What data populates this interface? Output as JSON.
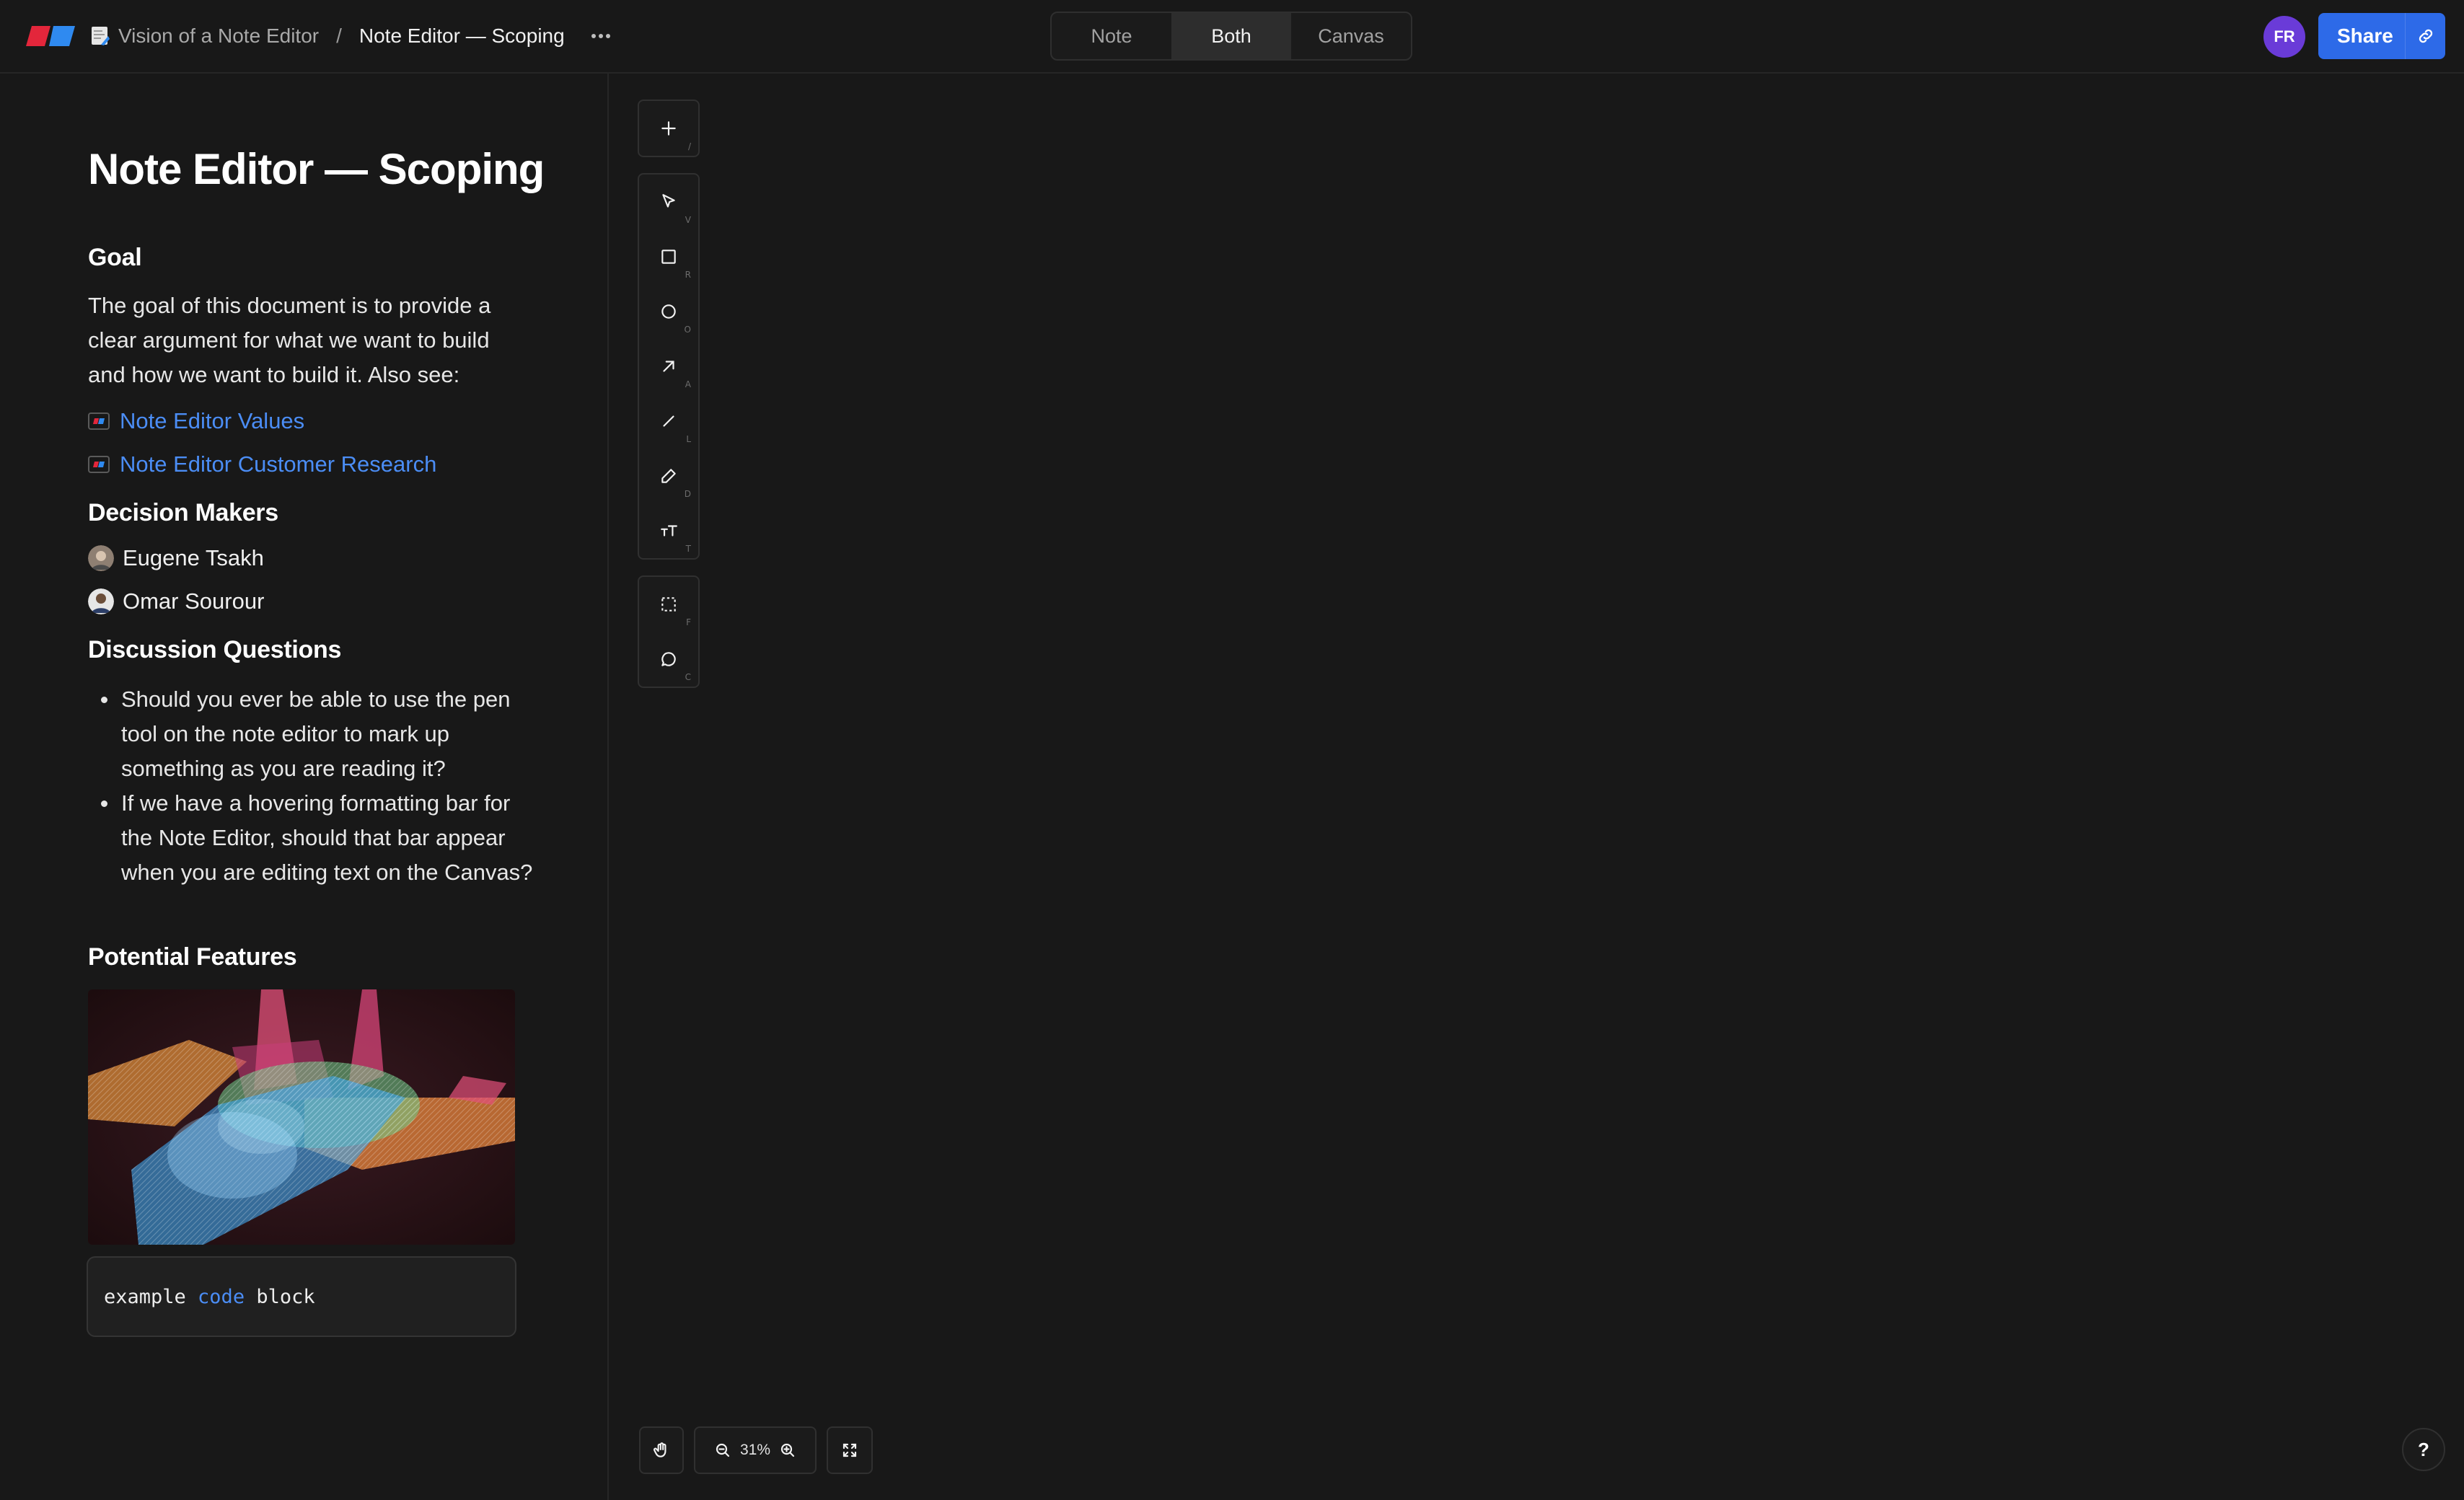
{
  "header": {
    "workspace_title": "Vision of a Note Editor",
    "separator": "/",
    "current_title": "Note Editor — Scoping",
    "view_modes": [
      "Note",
      "Both",
      "Canvas"
    ],
    "active_view": "Both",
    "avatar_initials": "FR",
    "share_label": "Share"
  },
  "note": {
    "title": "Note Editor — Scoping",
    "goal_heading": "Goal",
    "goal_text": "The goal of this document is to provide a clear argument for what we want to build and how we want to build it. Also see:",
    "links": [
      "Note Editor Values",
      "Note Editor Customer Research"
    ],
    "decision_heading": "Decision Makers",
    "people": [
      "Eugene Tsakh",
      "Omar Sourour"
    ],
    "questions_heading": "Discussion Questions",
    "questions": [
      "Should you ever be able to use the pen tool on the note editor to mark up something as you are reading it?",
      "If we have a hovering formatting bar for the Note Editor, should that bar appear when you are editing text on the Canvas?"
    ],
    "features_heading": "Potential Features",
    "code_block": {
      "before": "example ",
      "keyword": "code",
      "after": " block"
    }
  },
  "toolbar": {
    "add_key": "/",
    "tools": [
      {
        "name": "select",
        "key": "V"
      },
      {
        "name": "rectangle",
        "key": "R"
      },
      {
        "name": "ellipse",
        "key": "O"
      },
      {
        "name": "arrow",
        "key": "A"
      },
      {
        "name": "line",
        "key": "L"
      },
      {
        "name": "pencil",
        "key": "D"
      },
      {
        "name": "text",
        "key": "T"
      }
    ],
    "frame_key": "F",
    "comment_key": "C"
  },
  "canvas_controls": {
    "zoom": "31%",
    "help_label": "?"
  },
  "colors": {
    "accent": "#2d6ae8",
    "link": "#4b8df5",
    "avatar": "#6a3bd8",
    "background": "#181818"
  }
}
